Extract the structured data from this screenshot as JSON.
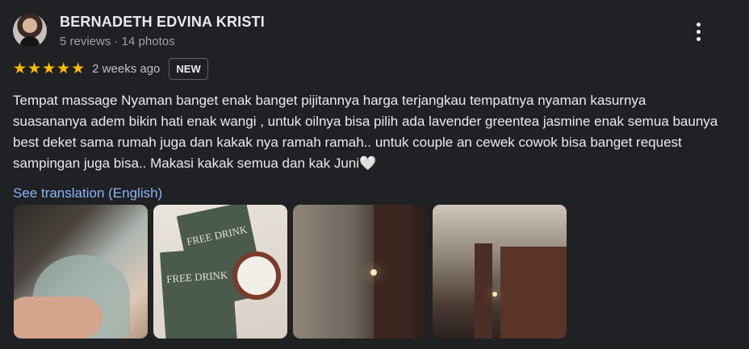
{
  "reviewer": {
    "name": "BERNADETH EDVINA KRISTI",
    "meta": "5 reviews · 14 photos"
  },
  "rating": {
    "stars": "★★★★★",
    "value": 5,
    "max": 5,
    "time": "2 weeks ago",
    "badge": "NEW"
  },
  "review": {
    "text": "Tempat massage Nyaman banget enak banget pijitannya harga terjangkau tempatnya nyaman kasurnya suasananya adem bikin hati enak wangi , untuk oilnya bisa pilih ada lavender greentea jasmine enak semua baunya best deket sama rumah juga dan kakak nya ramah ramah.. untuk couple an cewek cowok bisa banget request sampingan juga bisa.. Makasi kakak semua dan kak Juni🤍",
    "translate_link": "See translation (English)"
  },
  "photos": {
    "card_text_1": "FREE DRINK",
    "card_text_2": "FREE DRINK"
  },
  "colors": {
    "background": "#202124",
    "star": "#fbbc04",
    "link": "#8ab4f8"
  }
}
